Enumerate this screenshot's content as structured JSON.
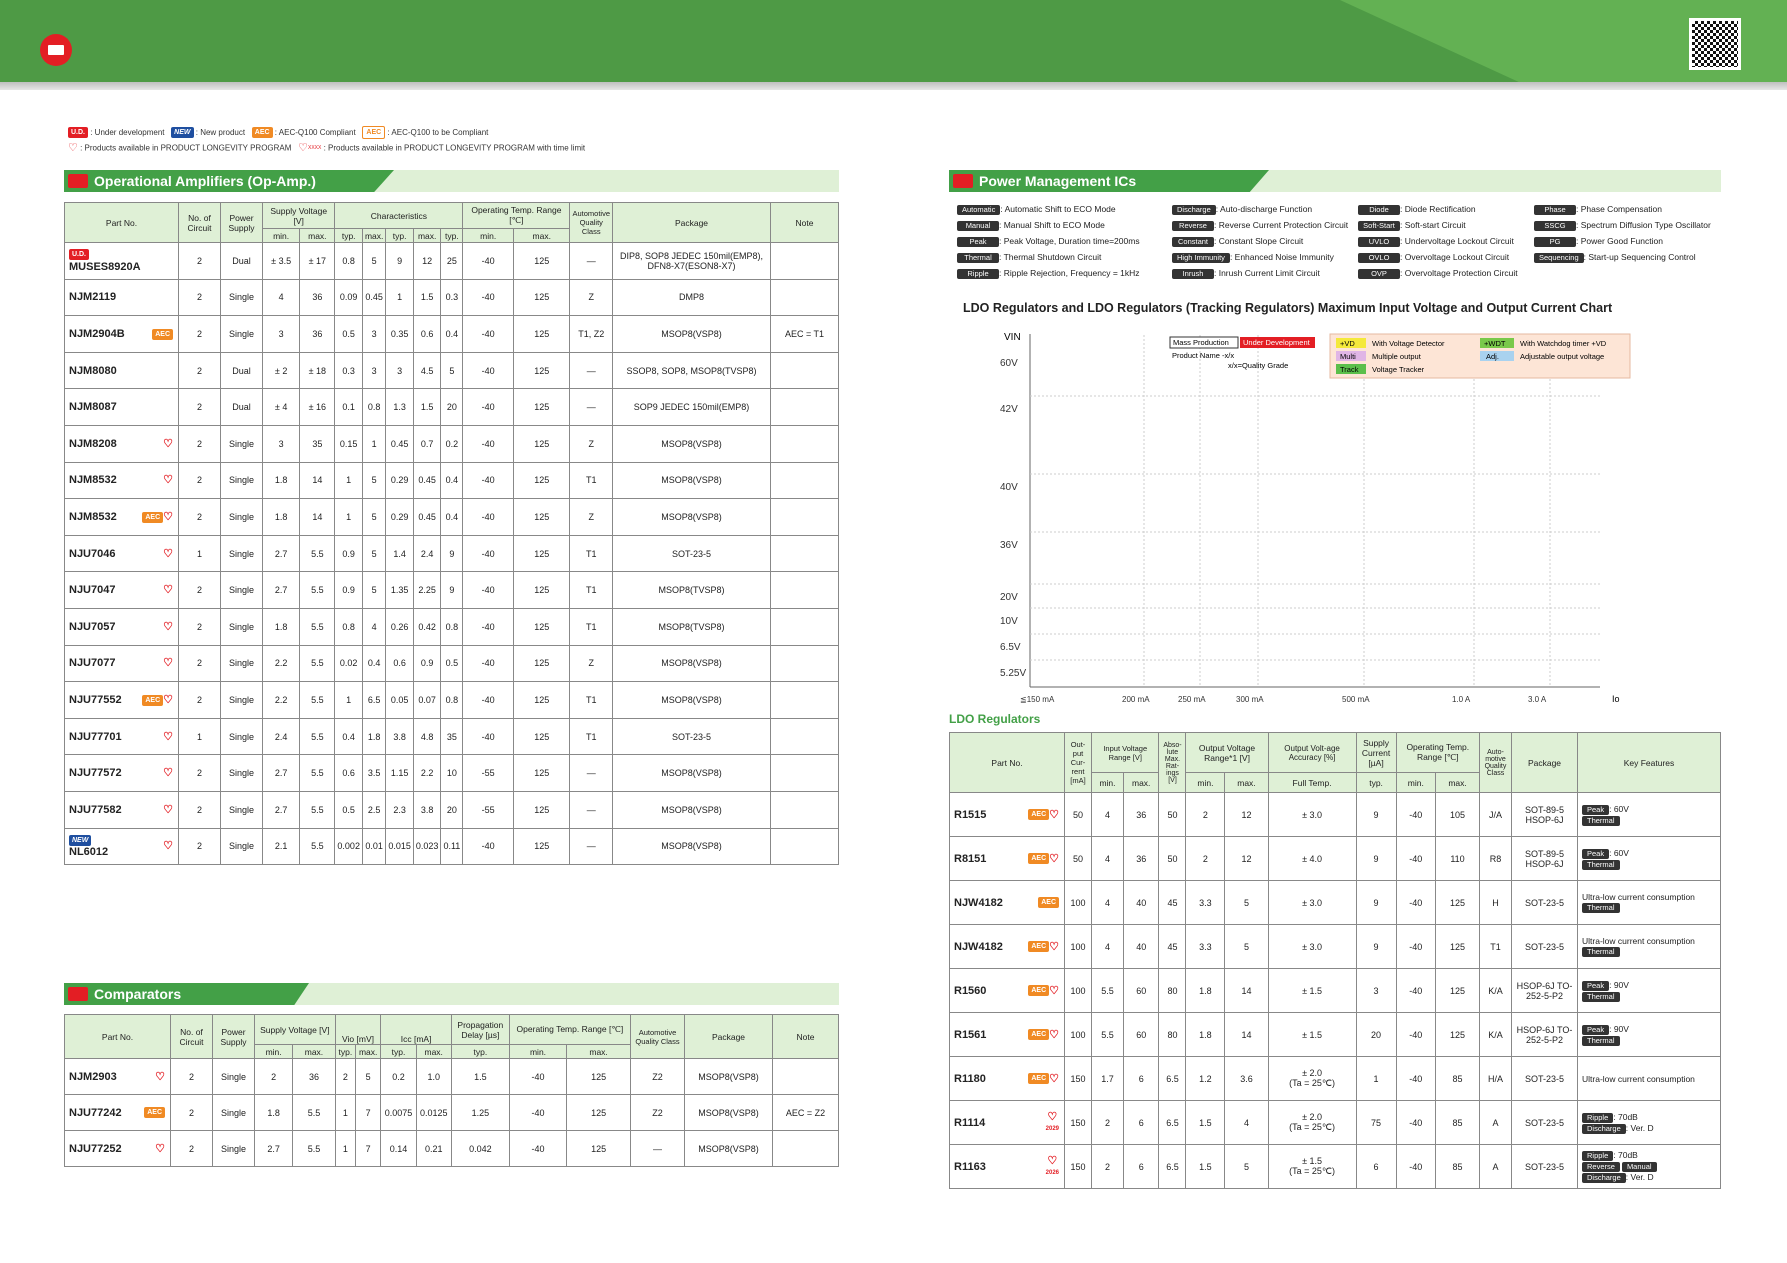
{
  "legend": {
    "ud": {
      "tag": "U.D.",
      "text": ": Under development"
    },
    "new": {
      "tag": "NEW",
      "text": ": New product"
    },
    "aec": {
      "tag": "AEC",
      "text": ": AEC-Q100 Compliant"
    },
    "aec2": {
      "tag": "AEC",
      "text": ": AEC-Q100 to be Compliant"
    },
    "heart": ": Products available in PRODUCT LONGEVITY PROGRAM",
    "heart_time": ": Products available in PRODUCT LONGEVITY PROGRAM with time limit",
    "xxxx": "XXXX"
  },
  "sections": {
    "opamp": "Operational Amplifiers (Op-Amp.)",
    "comparators": "Comparators",
    "pmic": "Power Management ICs"
  },
  "opamp": {
    "headers": {
      "part": "Part No.",
      "circuits": "No. of Circuit",
      "power": "Power Supply",
      "supply": "Supply Voltage [V]",
      "char": "Characteristics",
      "vio": "Vio [mV]",
      "icc": "Icc [mA]",
      "sr": "SR [V/µs]",
      "temp": "Operating Temp. Range [℃]",
      "auto": "Automotive Quality Class",
      "pkg": "Package",
      "note": "Note",
      "min": "min.",
      "max": "max.",
      "typ": "typ."
    },
    "rows": [
      {
        "part": "MUSES8920A",
        "ud": "U.D.",
        "circ": "2",
        "pwr": "Dual",
        "vmin": "± 3.5",
        "vmax": "± 17",
        "v1": "0.8",
        "v2": "5",
        "i1": "9",
        "i2": "12",
        "sr": "25",
        "tmin": "-40",
        "tmax": "125",
        "auto": "—",
        "pkg": "DIP8, SOP8 JEDEC 150mil(EMP8), DFN8-X7(ESON8-X7)",
        "note": "",
        "aec": "",
        "heart": false
      },
      {
        "part": "NJM2119",
        "circ": "2",
        "pwr": "Single",
        "vmin": "4",
        "vmax": "36",
        "v1": "0.09",
        "v2": "0.45",
        "i1": "1",
        "i2": "1.5",
        "sr": "0.3",
        "tmin": "-40",
        "tmax": "125",
        "auto": "Z",
        "pkg": "DMP8",
        "note": "",
        "aec": "",
        "heart": false
      },
      {
        "part": "NJM2904B",
        "circ": "2",
        "pwr": "Single",
        "vmin": "3",
        "vmax": "36",
        "v1": "0.5",
        "v2": "3",
        "i1": "0.35",
        "i2": "0.6",
        "sr": "0.4",
        "tmin": "-40",
        "tmax": "125",
        "auto": "T1, Z2",
        "pkg": "MSOP8(VSP8)",
        "note": "AEC = T1",
        "aec": "AEC",
        "heart": false
      },
      {
        "part": "NJM8080",
        "circ": "2",
        "pwr": "Dual",
        "vmin": "± 2",
        "vmax": "± 18",
        "v1": "0.3",
        "v2": "3",
        "i1": "3",
        "i2": "4.5",
        "sr": "5",
        "tmin": "-40",
        "tmax": "125",
        "auto": "—",
        "pkg": "SSOP8, SOP8, MSOP8(TVSP8)",
        "note": "",
        "aec": "",
        "heart": false
      },
      {
        "part": "NJM8087",
        "circ": "2",
        "pwr": "Dual",
        "vmin": "± 4",
        "vmax": "± 16",
        "v1": "0.1",
        "v2": "0.8",
        "i1": "1.3",
        "i2": "1.5",
        "sr": "20",
        "tmin": "-40",
        "tmax": "125",
        "auto": "—",
        "pkg": "SOP9 JEDEC 150mil(EMP8)",
        "note": "",
        "aec": "",
        "heart": false
      },
      {
        "part": "NJM8208",
        "circ": "2",
        "pwr": "Single",
        "vmin": "3",
        "vmax": "35",
        "v1": "0.15",
        "v2": "1",
        "i1": "0.45",
        "i2": "0.7",
        "sr": "0.2",
        "tmin": "-40",
        "tmax": "125",
        "auto": "Z",
        "pkg": "MSOP8(VSP8)",
        "note": "",
        "aec": "",
        "heart": true
      },
      {
        "part": "NJM8532",
        "circ": "2",
        "pwr": "Single",
        "vmin": "1.8",
        "vmax": "14",
        "v1": "1",
        "v2": "5",
        "i1": "0.29",
        "i2": "0.45",
        "sr": "0.4",
        "tmin": "-40",
        "tmax": "125",
        "auto": "T1",
        "pkg": "MSOP8(VSP8)",
        "note": "",
        "aec": "",
        "heart": true
      },
      {
        "part": "NJM8532",
        "circ": "2",
        "pwr": "Single",
        "vmin": "1.8",
        "vmax": "14",
        "v1": "1",
        "v2": "5",
        "i1": "0.29",
        "i2": "0.45",
        "sr": "0.4",
        "tmin": "-40",
        "tmax": "125",
        "auto": "Z",
        "pkg": "MSOP8(VSP8)",
        "note": "",
        "aec": "AEC",
        "heart": true
      },
      {
        "part": "NJU7046",
        "circ": "1",
        "pwr": "Single",
        "vmin": "2.7",
        "vmax": "5.5",
        "v1": "0.9",
        "v2": "5",
        "i1": "1.4",
        "i2": "2.4",
        "sr": "9",
        "tmin": "-40",
        "tmax": "125",
        "auto": "T1",
        "pkg": "SOT-23-5",
        "note": "",
        "aec": "",
        "heart": true
      },
      {
        "part": "NJU7047",
        "circ": "2",
        "pwr": "Single",
        "vmin": "2.7",
        "vmax": "5.5",
        "v1": "0.9",
        "v2": "5",
        "i1": "1.35",
        "i2": "2.25",
        "sr": "9",
        "tmin": "-40",
        "tmax": "125",
        "auto": "T1",
        "pkg": "MSOP8(TVSP8)",
        "note": "",
        "aec": "",
        "heart": true
      },
      {
        "part": "NJU7057",
        "circ": "2",
        "pwr": "Single",
        "vmin": "1.8",
        "vmax": "5.5",
        "v1": "0.8",
        "v2": "4",
        "i1": "0.26",
        "i2": "0.42",
        "sr": "0.8",
        "tmin": "-40",
        "tmax": "125",
        "auto": "T1",
        "pkg": "MSOP8(TVSP8)",
        "note": "",
        "aec": "",
        "heart": true
      },
      {
        "part": "NJU7077",
        "circ": "2",
        "pwr": "Single",
        "vmin": "2.2",
        "vmax": "5.5",
        "v1": "0.02",
        "v2": "0.4",
        "i1": "0.6",
        "i2": "0.9",
        "sr": "0.5",
        "tmin": "-40",
        "tmax": "125",
        "auto": "Z",
        "pkg": "MSOP8(VSP8)",
        "note": "",
        "aec": "",
        "heart": true
      },
      {
        "part": "NJU77552",
        "circ": "2",
        "pwr": "Single",
        "vmin": "2.2",
        "vmax": "5.5",
        "v1": "1",
        "v2": "6.5",
        "i1": "0.05",
        "i2": "0.07",
        "sr": "0.8",
        "tmin": "-40",
        "tmax": "125",
        "auto": "T1",
        "pkg": "MSOP8(VSP8)",
        "note": "",
        "aec": "AEC",
        "heart": true
      },
      {
        "part": "NJU77701",
        "circ": "1",
        "pwr": "Single",
        "vmin": "2.4",
        "vmax": "5.5",
        "v1": "0.4",
        "v2": "1.8",
        "i1": "3.8",
        "i2": "4.8",
        "sr": "35",
        "tmin": "-40",
        "tmax": "125",
        "auto": "T1",
        "pkg": "SOT-23-5",
        "note": "",
        "aec": "",
        "heart": true
      },
      {
        "part": "NJU77572",
        "circ": "2",
        "pwr": "Single",
        "vmin": "2.7",
        "vmax": "5.5",
        "v1": "0.6",
        "v2": "3.5",
        "i1": "1.15",
        "i2": "2.2",
        "sr": "10",
        "tmin": "-55",
        "tmax": "125",
        "auto": "—",
        "pkg": "MSOP8(VSP8)",
        "note": "",
        "aec": "",
        "heart": true
      },
      {
        "part": "NJU77582",
        "circ": "2",
        "pwr": "Single",
        "vmin": "2.7",
        "vmax": "5.5",
        "v1": "0.5",
        "v2": "2.5",
        "i1": "2.3",
        "i2": "3.8",
        "sr": "20",
        "tmin": "-55",
        "tmax": "125",
        "auto": "—",
        "pkg": "MSOP8(VSP8)",
        "note": "",
        "aec": "",
        "heart": true
      },
      {
        "part": "NL6012",
        "new": "NEW",
        "circ": "2",
        "pwr": "Single",
        "vmin": "2.1",
        "vmax": "5.5",
        "v1": "0.002",
        "v2": "0.01",
        "i1": "0.015",
        "i2": "0.023",
        "sr": "0.11",
        "tmin": "-40",
        "tmax": "125",
        "auto": "—",
        "pkg": "MSOP8(VSP8)",
        "note": "",
        "aec": "",
        "heart": true
      }
    ]
  },
  "comparators": {
    "headers": {
      "part": "Part No.",
      "circuits": "No. of Circuit",
      "power": "Power Supply",
      "supply": "Supply Voltage [V]",
      "char": "Characteristics",
      "vio": "Vio [mV]",
      "icc": "Icc [mA]",
      "delay": "Propagation Delay [µs]",
      "temp": "Operating Temp. Range [℃]",
      "auto": "Automotive Quality Class",
      "pkg": "Package",
      "note": "Note",
      "min": "min.",
      "max": "max.",
      "typ": "typ."
    },
    "rows": [
      {
        "part": "NJM2903",
        "circ": "2",
        "pwr": "Single",
        "vmin": "2",
        "vmax": "36",
        "v1": "2",
        "v2": "5",
        "i1": "0.2",
        "i2": "1.0",
        "d": "1.5",
        "tmin": "-40",
        "tmax": "125",
        "auto": "Z2",
        "pkg": "MSOP8(VSP8)",
        "note": "",
        "aec": "",
        "heart": true
      },
      {
        "part": "NJU77242",
        "circ": "2",
        "pwr": "Single",
        "vmin": "1.8",
        "vmax": "5.5",
        "v1": "1",
        "v2": "7",
        "i1": "0.0075",
        "i2": "0.0125",
        "d": "1.25",
        "tmin": "-40",
        "tmax": "125",
        "auto": "Z2",
        "pkg": "MSOP8(VSP8)",
        "note": "AEC = Z2",
        "aec": "AEC",
        "heart": false
      },
      {
        "part": "NJU77252",
        "circ": "2",
        "pwr": "Single",
        "vmin": "2.7",
        "vmax": "5.5",
        "v1": "1",
        "v2": "7",
        "i1": "0.14",
        "i2": "0.21",
        "d": "0.042",
        "tmin": "-40",
        "tmax": "125",
        "auto": "—",
        "pkg": "MSOP8(VSP8)",
        "note": "",
        "aec": "",
        "heart": true
      }
    ]
  },
  "pmic_legend": [
    [
      {
        "tag": "Automatic",
        "text": ": Automatic Shift to ECO Mode"
      },
      {
        "tag": "Discharge",
        "text": ": Auto-discharge Function"
      },
      {
        "tag": "Diode",
        "text": ": Diode Rectification"
      },
      {
        "tag": "Phase",
        "text": ": Phase Compensation"
      }
    ],
    [
      {
        "tag": "Manual",
        "text": ": Manual Shift to ECO Mode"
      },
      {
        "tag": "Reverse",
        "text": ": Reverse Current Protection Circuit"
      },
      {
        "tag": "Soft-Start",
        "text": ": Soft-start Circuit"
      },
      {
        "tag": "SSCG",
        "text": ": Spectrum Diffusion Type Oscillator"
      }
    ],
    [
      {
        "tag": "Peak",
        "text": ": Peak Voltage, Duration time=200ms"
      },
      {
        "tag": "Constant",
        "text": ": Constant Slope Circuit"
      },
      {
        "tag": "UVLO",
        "text": ": Undervoltage Lockout Circuit"
      },
      {
        "tag": "PG",
        "text": ": Power Good Function"
      }
    ],
    [
      {
        "tag": "Thermal",
        "text": ": Thermal Shutdown Circuit"
      },
      {
        "tag": "High Immunity",
        "text": ": Enhanced Noise Immunity"
      },
      {
        "tag": "OVLO",
        "text": ": Overvoltage Lockout Circuit"
      },
      {
        "tag": "Sequencing",
        "text": ": Start-up Sequencing Control"
      }
    ],
    [
      {
        "tag": "Ripple",
        "text": ": Ripple Rejection, Frequency = 1kHz"
      },
      {
        "tag": "Inrush",
        "text": ": Inrush Current Limit Circuit"
      },
      {
        "tag": "OVP",
        "text": ": Overvoltage Protection Circuit"
      },
      {
        "tag": "",
        "text": ""
      }
    ]
  ],
  "chart": {
    "title": "LDO Regulators and LDO Regulators (Tracking Regulators) Maximum Input Voltage and Output Current Chart",
    "vin": "VIN",
    "io": "Io",
    "y_labels": [
      "60V",
      "42V",
      "40V",
      "36V",
      "20V",
      "10V",
      "6.5V",
      "5.25V"
    ],
    "x_labels": [
      "≦150 mA",
      "200 mA",
      "250 mA",
      "300 mA",
      "500 mA",
      "1.0 A",
      "3.0 A"
    ],
    "legend": {
      "mass": "Mass Production",
      "ud": "Under Development",
      "namefmt": "Product Name -x/x",
      "grade": "x/x=Quality Grade",
      "vd": "+VD",
      "vd_t": "With Voltage Detector",
      "wdt": "+WDT",
      "wdt_t": "With Watchdog timer +VD",
      "multi": "Multi",
      "multi_t": "Multiple output",
      "adj": "Adj.",
      "adj_t": "Adjustable output voltage",
      "track": "Track",
      "track_t": "Voltage Tracker"
    }
  },
  "ldo": {
    "title": "LDO Regulators",
    "headers": {
      "part": "Part No.",
      "out": "Out-put Cur-rent [mA]",
      "input": "Input Voltage Range [V]",
      "abs": "Abso-lute Max. Rat-ings [V]",
      "outv": "Output Voltage Range*1 [V]",
      "acc": "Output Volt-age Accuracy [%]",
      "supply": "Supply Current [µA]",
      "temp": "Operating Temp. Range [℃]",
      "auto": "Auto-motive Quality Class",
      "pkg": "Package",
      "kf": "Key Features",
      "min": "min.",
      "max": "max.",
      "full": "Full Temp.",
      "typ": "typ."
    },
    "rows": [
      {
        "part": "R1515",
        "aec": "AEC",
        "heart": true,
        "io": "50",
        "imin": "4",
        "imax": "36",
        "abs": "50",
        "omin": "2",
        "omax": "12",
        "acc": "± 3.0",
        "acc2": "",
        "sc": "9",
        "tmin": "-40",
        "tmax": "105",
        "auto": "J/A",
        "pkg": "SOT-89-5 HSOP-6J",
        "kf1tag": "Peak",
        "kf1": ": 60V",
        "kf2tag": "Thermal",
        "kf2": ""
      },
      {
        "part": "R8151",
        "aec": "AEC",
        "heart": true,
        "io": "50",
        "imin": "4",
        "imax": "36",
        "abs": "50",
        "omin": "2",
        "omax": "12",
        "acc": "± 4.0",
        "acc2": "",
        "sc": "9",
        "tmin": "-40",
        "tmax": "110",
        "auto": "R8",
        "pkg": "SOT-89-5 HSOP-6J",
        "kf1tag": "Peak",
        "kf1": ": 60V",
        "kf2tag": "Thermal",
        "kf2": ""
      },
      {
        "part": "NJW4182",
        "aec": "AEC",
        "heart": false,
        "io": "100",
        "imin": "4",
        "imax": "40",
        "abs": "45",
        "omin": "3.3",
        "omax": "5",
        "acc": "± 3.0",
        "acc2": "",
        "sc": "9",
        "tmin": "-40",
        "tmax": "125",
        "auto": "H",
        "pkg": "SOT-23-5",
        "kf1tag": "",
        "kf1": "Ultra-low current consumption",
        "kf2tag": "Thermal",
        "kf2": ""
      },
      {
        "part": "NJW4182",
        "aec": "AEC",
        "heart": true,
        "io": "100",
        "imin": "4",
        "imax": "40",
        "abs": "45",
        "omin": "3.3",
        "omax": "5",
        "acc": "± 3.0",
        "acc2": "",
        "sc": "9",
        "tmin": "-40",
        "tmax": "125",
        "auto": "T1",
        "pkg": "SOT-23-5",
        "kf1tag": "",
        "kf1": "Ultra-low current consumption",
        "kf2tag": "Thermal",
        "kf2": ""
      },
      {
        "part": "R1560",
        "aec": "AEC",
        "heart": true,
        "io": "100",
        "imin": "5.5",
        "imax": "60",
        "abs": "80",
        "omin": "1.8",
        "omax": "14",
        "acc": "± 1.5",
        "acc2": "",
        "sc": "3",
        "tmin": "-40",
        "tmax": "125",
        "auto": "K/A",
        "pkg": "HSOP-6J TO-252-5-P2",
        "kf1tag": "Peak",
        "kf1": ": 90V",
        "kf2tag": "Thermal",
        "kf2": ""
      },
      {
        "part": "R1561",
        "aec": "AEC",
        "heart": true,
        "io": "100",
        "imin": "5.5",
        "imax": "60",
        "abs": "80",
        "omin": "1.8",
        "omax": "14",
        "acc": "± 1.5",
        "acc2": "",
        "sc": "20",
        "tmin": "-40",
        "tmax": "125",
        "auto": "K/A",
        "pkg": "HSOP-6J TO-252-5-P2",
        "kf1tag": "Peak",
        "kf1": ": 90V",
        "kf2tag": "Thermal",
        "kf2": ""
      },
      {
        "part": "R1180",
        "aec": "AEC",
        "heart": true,
        "io": "150",
        "imin": "1.7",
        "imax": "6",
        "abs": "6.5",
        "omin": "1.2",
        "omax": "3.6",
        "acc": "± 2.0",
        "acc2": "(Ta = 25℃)",
        "sc": "1",
        "tmin": "-40",
        "tmax": "85",
        "auto": "H/A",
        "pkg": "SOT-23-5",
        "kf1tag": "",
        "kf1": "Ultra-low current consumption",
        "kf2tag": "",
        "kf2": ""
      },
      {
        "part": "R1114",
        "aec": "",
        "heart": true,
        "year": "2029",
        "io": "150",
        "imin": "2",
        "imax": "6",
        "abs": "6.5",
        "omin": "1.5",
        "omax": "4",
        "acc": "± 2.0",
        "acc2": "(Ta = 25℃)",
        "sc": "75",
        "tmin": "-40",
        "tmax": "85",
        "auto": "A",
        "pkg": "SOT-23-5",
        "kf1tag": "Ripple",
        "kf1": ": 70dB",
        "kf2tag": "Discharge",
        "kf2": ": Ver. D"
      },
      {
        "part": "R1163",
        "aec": "",
        "heart": true,
        "year": "2026",
        "io": "150",
        "imin": "2",
        "imax": "6",
        "abs": "6.5",
        "omin": "1.5",
        "omax": "5",
        "acc": "± 1.5",
        "acc2": "(Ta = 25℃)",
        "sc": "6",
        "tmin": "-40",
        "tmax": "85",
        "auto": "A",
        "pkg": "SOT-23-5",
        "kf1tag": "Ripple",
        "kf1": ": 70dB",
        "kf2tag": "Reverse",
        "kf2": "Manual",
        "kf3tag": "Discharge",
        "kf3": ": Ver. D"
      }
    ]
  }
}
